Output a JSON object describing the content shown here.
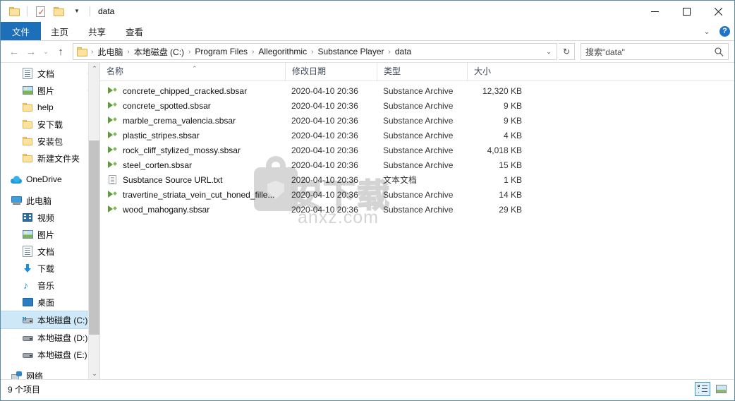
{
  "window": {
    "title": "data",
    "quick_access": [
      "folder-icon",
      "properties-icon",
      "new-folder-icon",
      "customize-dropdown"
    ],
    "controls": {
      "minimize": "minimize-icon",
      "maximize": "maximize-icon",
      "close": "close-icon"
    }
  },
  "ribbon": {
    "tabs": [
      {
        "label": "文件",
        "active": true
      },
      {
        "label": "主页",
        "active": false
      },
      {
        "label": "共享",
        "active": false
      },
      {
        "label": "查看",
        "active": false
      }
    ],
    "collapse_icon": "chevron-down-icon",
    "help_label": "?"
  },
  "address": {
    "back_icon": "←",
    "forward_icon": "→",
    "recent_icon": "⌄",
    "up_icon": "↑",
    "breadcrumb": [
      "此电脑",
      "本地磁盘 (C:)",
      "Program Files",
      "Allegorithmic",
      "Substance Player",
      "data"
    ],
    "breadcrumb_separator": "›",
    "dropdown_icon": "⌄",
    "refresh_icon": "↻"
  },
  "search": {
    "placeholder": "搜索\"data\"",
    "icon": "search-icon"
  },
  "sidebar": {
    "items": [
      {
        "label": "文档",
        "icon": "document-icon",
        "indent": 1,
        "pinned": true,
        "selected": false
      },
      {
        "label": "图片",
        "icon": "pictures-icon",
        "indent": 1,
        "pinned": true,
        "selected": false
      },
      {
        "label": "help",
        "icon": "folder-icon",
        "indent": 1,
        "pinned": false,
        "selected": false
      },
      {
        "label": "安下载",
        "icon": "folder-icon",
        "indent": 1,
        "pinned": false,
        "selected": false
      },
      {
        "label": "安装包",
        "icon": "folder-icon",
        "indent": 1,
        "pinned": false,
        "selected": false
      },
      {
        "label": "新建文件夹",
        "icon": "folder-icon",
        "indent": 1,
        "pinned": false,
        "selected": false
      },
      {
        "label": "OneDrive",
        "icon": "onedrive-icon",
        "indent": 0,
        "pinned": false,
        "selected": false
      },
      {
        "label": "此电脑",
        "icon": "this-pc-icon",
        "indent": 0,
        "pinned": false,
        "selected": false
      },
      {
        "label": "视频",
        "icon": "videos-icon",
        "indent": 1,
        "pinned": false,
        "selected": false
      },
      {
        "label": "图片",
        "icon": "pictures-icon",
        "indent": 1,
        "pinned": false,
        "selected": false
      },
      {
        "label": "文档",
        "icon": "document-icon",
        "indent": 1,
        "pinned": false,
        "selected": false
      },
      {
        "label": "下载",
        "icon": "downloads-icon",
        "indent": 1,
        "pinned": false,
        "selected": false
      },
      {
        "label": "音乐",
        "icon": "music-icon",
        "indent": 1,
        "pinned": false,
        "selected": false
      },
      {
        "label": "桌面",
        "icon": "desktop-icon",
        "indent": 1,
        "pinned": false,
        "selected": false
      },
      {
        "label": "本地磁盘 (C:)",
        "icon": "system-drive-icon",
        "indent": 1,
        "pinned": false,
        "selected": true
      },
      {
        "label": "本地磁盘 (D:)",
        "icon": "drive-icon",
        "indent": 1,
        "pinned": false,
        "selected": false
      },
      {
        "label": "本地磁盘 (E:)",
        "icon": "drive-icon",
        "indent": 1,
        "pinned": false,
        "selected": false
      },
      {
        "label": "网络",
        "icon": "network-icon",
        "indent": 0,
        "pinned": false,
        "selected": false
      }
    ],
    "scroll_up_icon": "⌃",
    "scroll_down_icon": "⌄"
  },
  "filelist": {
    "columns": [
      {
        "label": "名称",
        "sorted": "asc"
      },
      {
        "label": "修改日期",
        "sorted": ""
      },
      {
        "label": "类型",
        "sorted": ""
      },
      {
        "label": "大小",
        "sorted": ""
      }
    ],
    "sort_caret": "⌃",
    "rows": [
      {
        "name": "concrete_chipped_cracked.sbsar",
        "date": "2020-04-10 20:36",
        "type": "Substance Archive",
        "size": "12,320 KB",
        "icon": "sbsar-icon"
      },
      {
        "name": "concrete_spotted.sbsar",
        "date": "2020-04-10 20:36",
        "type": "Substance Archive",
        "size": "9 KB",
        "icon": "sbsar-icon"
      },
      {
        "name": "marble_crema_valencia.sbsar",
        "date": "2020-04-10 20:36",
        "type": "Substance Archive",
        "size": "9 KB",
        "icon": "sbsar-icon"
      },
      {
        "name": "plastic_stripes.sbsar",
        "date": "2020-04-10 20:36",
        "type": "Substance Archive",
        "size": "4 KB",
        "icon": "sbsar-icon"
      },
      {
        "name": "rock_cliff_stylized_mossy.sbsar",
        "date": "2020-04-10 20:36",
        "type": "Substance Archive",
        "size": "4,018 KB",
        "icon": "sbsar-icon"
      },
      {
        "name": "steel_corten.sbsar",
        "date": "2020-04-10 20:36",
        "type": "Substance Archive",
        "size": "15 KB",
        "icon": "sbsar-icon"
      },
      {
        "name": "Susbtance Source URL.txt",
        "date": "2020-04-10 20:36",
        "type": "文本文档",
        "size": "1 KB",
        "icon": "text-file-icon"
      },
      {
        "name": "travertine_striata_vein_cut_honed_fille...",
        "date": "2020-04-10 20:36",
        "type": "Substance Archive",
        "size": "14 KB",
        "icon": "sbsar-icon"
      },
      {
        "name": "wood_mahogany.sbsar",
        "date": "2020-04-10 20:36",
        "type": "Substance Archive",
        "size": "29 KB",
        "icon": "sbsar-icon"
      }
    ]
  },
  "watermark": {
    "text_cn": "安下载",
    "text_url": "anxz.com"
  },
  "statusbar": {
    "item_count": "9 个项目",
    "views": [
      {
        "name": "details-view",
        "active": true
      },
      {
        "name": "large-icons-view",
        "active": false
      }
    ]
  }
}
